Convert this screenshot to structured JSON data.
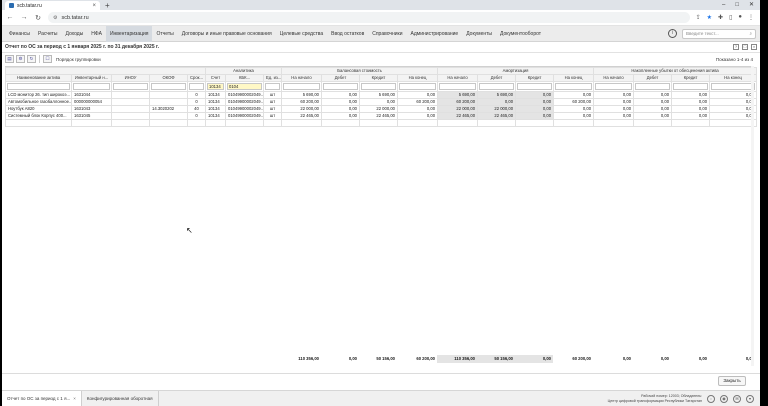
{
  "browser": {
    "tab_title": "scb.tatar.ru",
    "url": "scb.tatar.ru",
    "new_tab": "+",
    "win_min": "–",
    "win_max": "□",
    "win_close": "✕"
  },
  "menu": {
    "items": [
      "Финансы",
      "Расчеты",
      "Доходы",
      "НФА",
      "Инвентаризация",
      "Отчеты",
      "Договоры и иные правовые основания",
      "Целевые средства",
      "Ввод остатков",
      "Справочники",
      "Администрирование",
      "Документы",
      "Документооборот"
    ],
    "active_index": 4,
    "search_placeholder": "Введите текст...",
    "info_label": "i"
  },
  "report": {
    "title": "Отчет по ОС за период с 1 января 2025 г. по 31 декабря 2025 г.",
    "group_label": "Порядок группировки",
    "shown_label": "Показано 1-4 из 4"
  },
  "table": {
    "group_headers": {
      "analytics": "Аналитика",
      "balance": "Балансовая стоимость",
      "amort": "Амортизация",
      "loss": "Накопленные убытки от обесценения актива"
    },
    "columns": [
      "Наименование актива",
      "Инвентарный н...",
      "ИНОУ",
      "ОКОФ",
      "Срок...",
      "Счет",
      "КБК...",
      "Ед. из...",
      "На начало",
      "Дебет",
      "Кредит",
      "На конец",
      "На начало",
      "Дебет",
      "Кредит",
      "На конец",
      "На начало",
      "Дебет",
      "Кредит",
      "На конец"
    ],
    "filters": {
      "account": "10134",
      "kbk": "0104"
    },
    "rows": [
      [
        "LCD монитор 26. тип широкоэ...",
        "1631044",
        "",
        "",
        "0",
        "10134",
        "01049900002049...",
        "шт",
        "5 690,00",
        "0,00",
        "5 690,00",
        "0,00",
        "5 690,00",
        "5 690,00",
        "0,00",
        "0,00",
        "0,00",
        "0,00",
        "0,00",
        "0,00"
      ],
      [
        "Автомобильное газобаллонное...",
        "000000000054",
        "",
        "",
        "0",
        "10134",
        "01049900002049...",
        "шт",
        "60 200,00",
        "0,00",
        "0,00",
        "60 200,00",
        "60 200,00",
        "0,00",
        "0,00",
        "60 200,00",
        "0,00",
        "0,00",
        "0,00",
        "0,00"
      ],
      [
        "Ноутбук А820",
        "1631043",
        "",
        "14.3020202",
        "40",
        "10134",
        "01049900002049...",
        "шт",
        "22 000,00",
        "0,00",
        "22 000,00",
        "0,00",
        "22 000,00",
        "22 000,00",
        "0,00",
        "0,00",
        "0,00",
        "0,00",
        "0,00",
        "0,00"
      ],
      [
        "Системный блок Корпус 400...",
        "1631045",
        "",
        "",
        "0",
        "10134",
        "01049900002049...",
        "шт",
        "22 465,00",
        "0,00",
        "22 465,00",
        "0,00",
        "22 465,00",
        "22 465,00",
        "0,00",
        "0,00",
        "0,00",
        "0,00",
        "0,00",
        "0,00"
      ]
    ],
    "totals": [
      "110 356,00",
      "0,00",
      "50 156,00",
      "60 200,00",
      "110 356,00",
      "50 156,00",
      "0,00",
      "60 200,00",
      "0,00",
      "0,00",
      "0,00",
      "0,00"
    ]
  },
  "actions": {
    "close_label": "Закрыть"
  },
  "footer": {
    "tabs": [
      "Отчет по ОС за период с 1 я...",
      "Конфигурированная оборотная"
    ],
    "status_line1": "Рабочий номер: 12003; Обладатель:",
    "status_line2": "Центр цифровой трансформации Республики Татарстан"
  },
  "colors": {
    "accent": "#1a73e8",
    "menu_bg": "#ececec",
    "shaded_cell": "#e4e4e4",
    "filter_highlight": "#fff8c6"
  }
}
